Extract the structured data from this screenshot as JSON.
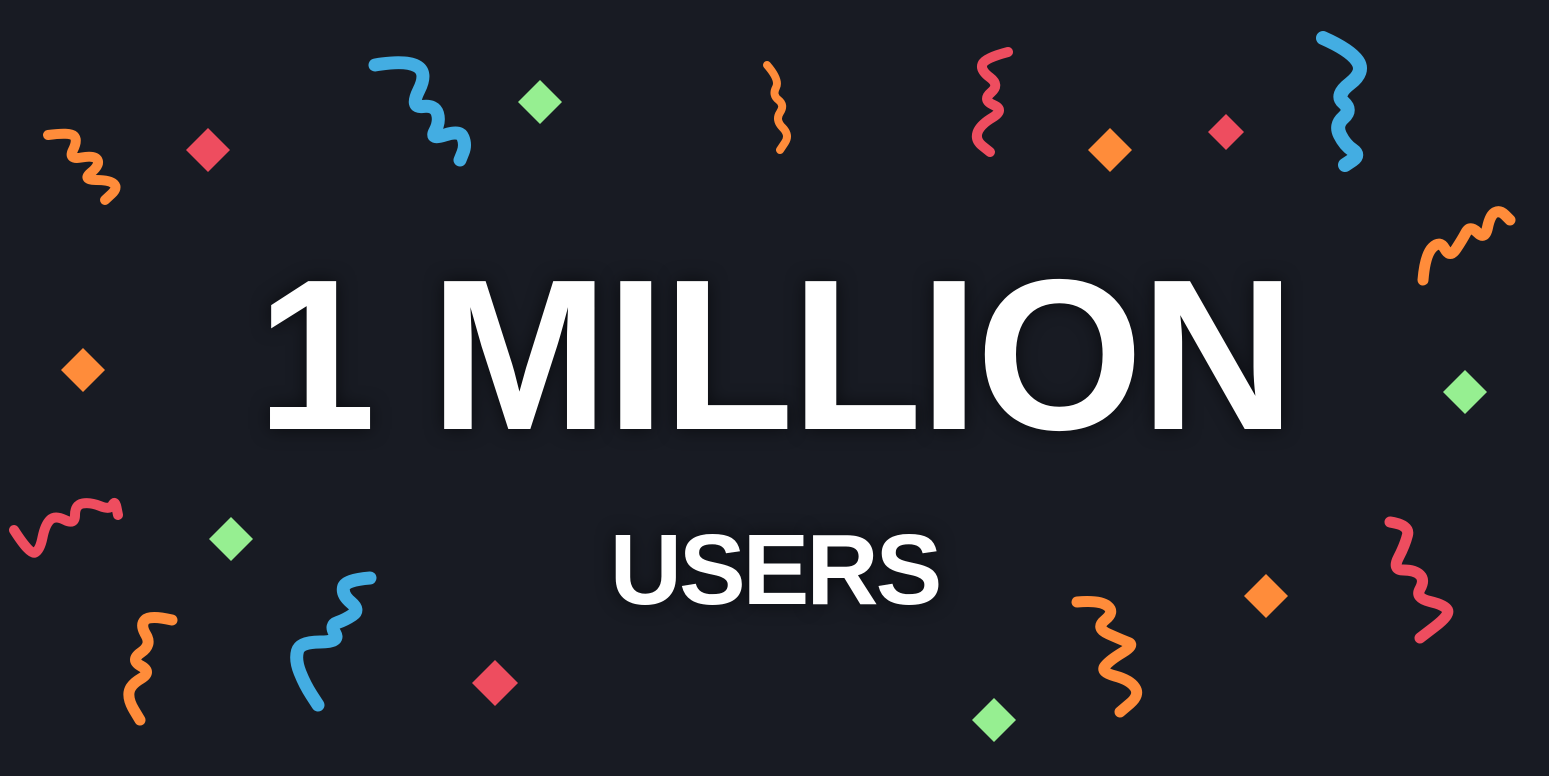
{
  "headline": "1 MILLION",
  "subheadline": "USERS",
  "colors": {
    "background": "#181b23",
    "red": "#ee4d5f",
    "orange": "#ff8c3a",
    "green": "#96ef91",
    "blue": "#43ade2",
    "text": "#ffffff"
  }
}
